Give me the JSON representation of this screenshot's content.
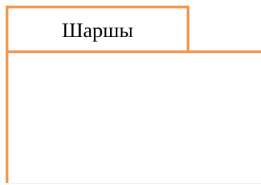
{
  "tab": {
    "label": "Шаршы"
  },
  "colors": {
    "accent": "#f0964d",
    "background": "#ffffff",
    "text": "#000000"
  }
}
